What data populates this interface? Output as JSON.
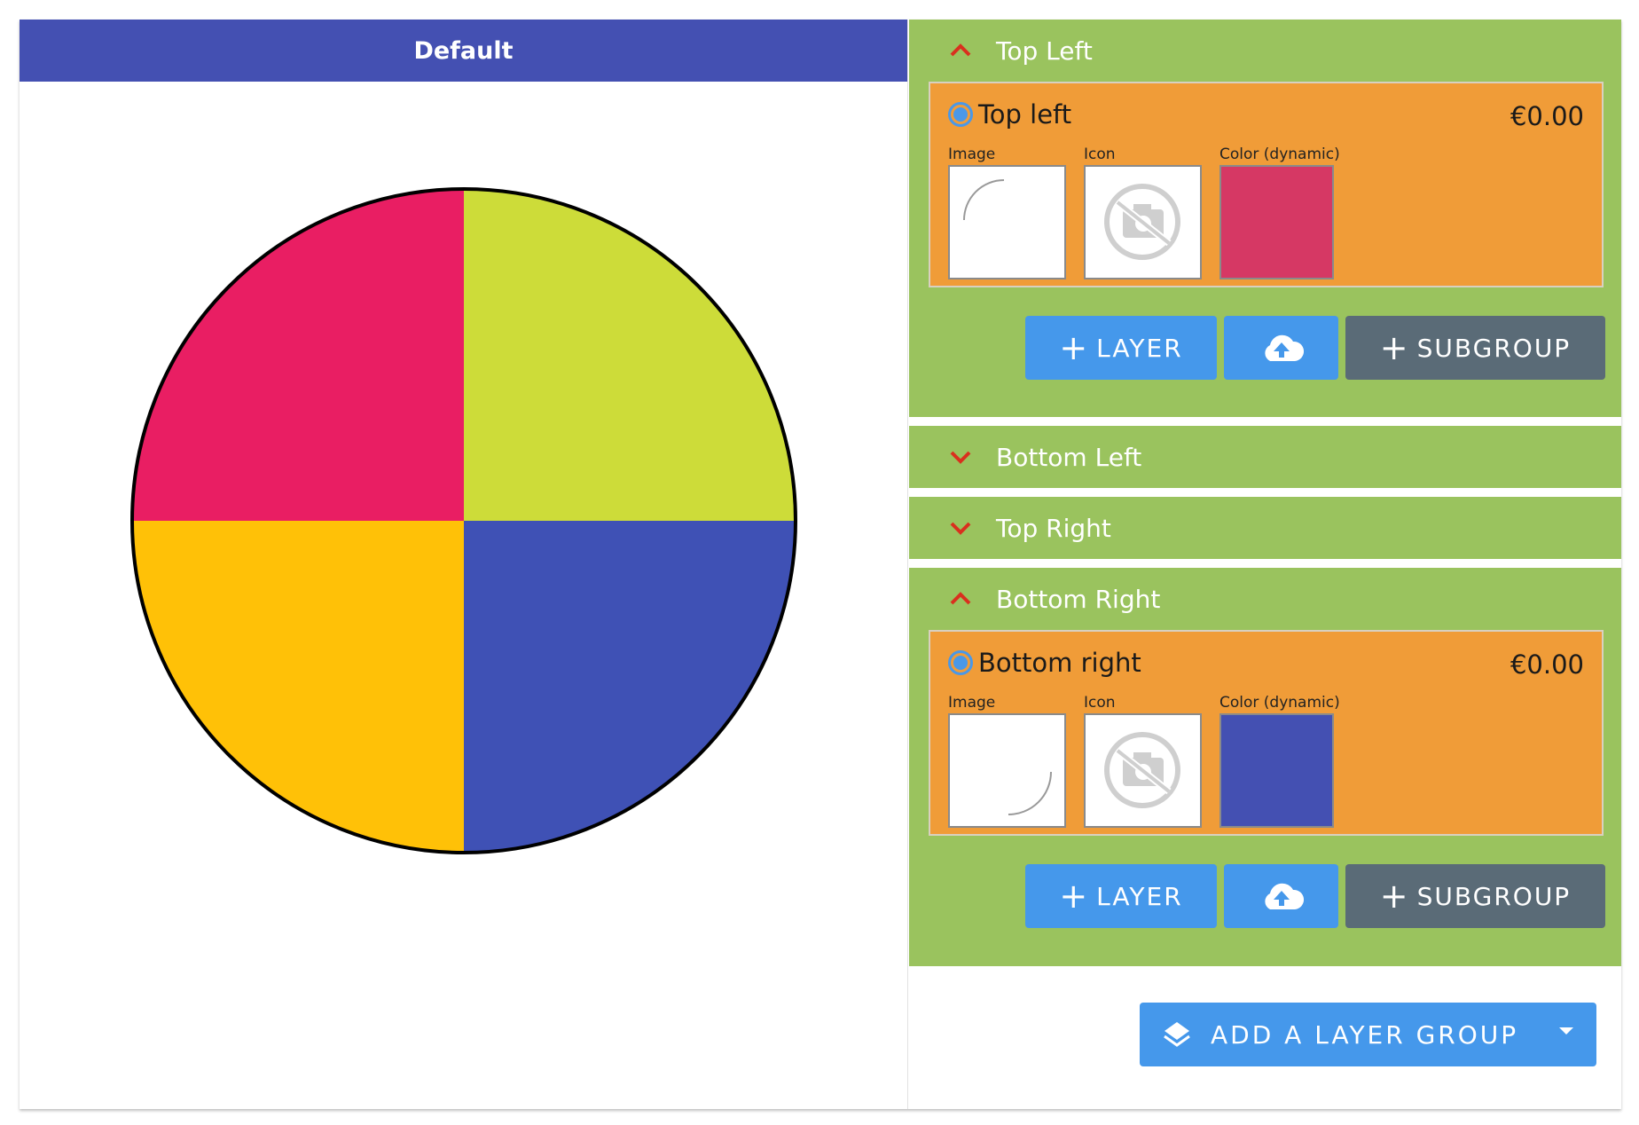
{
  "preview": {
    "title": "Default",
    "quadrants": [
      {
        "name": "top-left",
        "color": "#e91e63"
      },
      {
        "name": "top-right",
        "color": "#cddc39"
      },
      {
        "name": "bottom-left",
        "color": "#ffc107"
      },
      {
        "name": "bottom-right",
        "color": "#3f51b5"
      }
    ]
  },
  "panel": {
    "groups": [
      {
        "title": "Top Left",
        "expanded": true,
        "layer": {
          "name": "Top left",
          "price": "€0.00",
          "image_label": "Image",
          "icon_label": "Icon",
          "color_label": "Color (dynamic)",
          "color": "#d63864"
        },
        "buttons": {
          "layer": "LAYER",
          "subgroup": "SUBGROUP"
        }
      },
      {
        "title": "Bottom Left",
        "expanded": false
      },
      {
        "title": "Top Right",
        "expanded": false
      },
      {
        "title": "Bottom Right",
        "expanded": true,
        "layer": {
          "name": "Bottom right",
          "price": "€0.00",
          "image_label": "Image",
          "icon_label": "Icon",
          "color_label": "Color (dynamic)",
          "color": "#4450b2"
        },
        "buttons": {
          "layer": "LAYER",
          "subgroup": "SUBGROUP"
        }
      }
    ],
    "add_group_label": "ADD A LAYER GROUP"
  },
  "icons": {
    "chevron": "chevron-icon",
    "upload": "cloud-upload-icon",
    "layers": "layers-icon",
    "no-image": "no-photo-icon",
    "caret": "caret-down-icon"
  },
  "colors": {
    "header": "#4450b2",
    "group_bg": "#9ac35e",
    "layer_bg": "#f09c38",
    "button_blue": "#4598eb",
    "button_grey": "#5a6b77",
    "chevron": "#d9301e"
  }
}
